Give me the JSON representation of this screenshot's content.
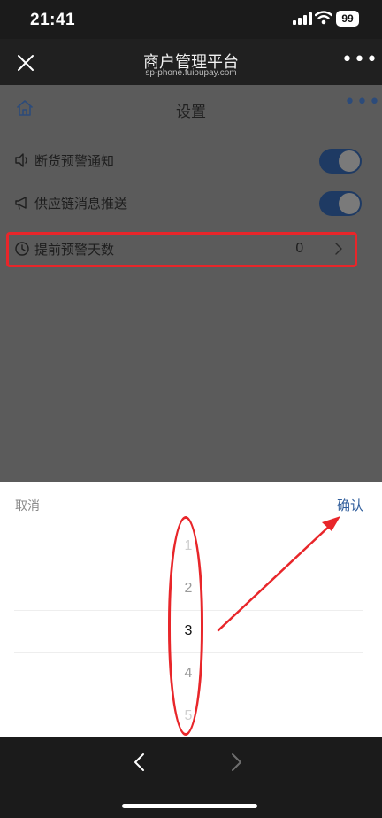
{
  "status": {
    "time": "21:41",
    "battery": "99"
  },
  "browser": {
    "title": "商户管理平台",
    "subtitle": "sp-phone.fuioupay.com"
  },
  "page": {
    "title": "设置",
    "rows": [
      {
        "label": "断货预警通知",
        "toggle": true
      },
      {
        "label": "供应链消息推送",
        "toggle": true
      },
      {
        "label": "提前预警天数",
        "value": "0"
      }
    ]
  },
  "picker": {
    "cancel_label": "取消",
    "confirm_label": "确认",
    "options": [
      "1",
      "2",
      "3",
      "4",
      "5"
    ],
    "selected": "3"
  },
  "colors": {
    "accent": "#2f5d9b",
    "annotation": "#e8262a"
  },
  "icons": [
    "close-icon",
    "more-icon",
    "home-icon",
    "speaker-icon",
    "megaphone-icon",
    "clock-icon",
    "chevron-right-icon",
    "back-icon",
    "forward-icon"
  ]
}
